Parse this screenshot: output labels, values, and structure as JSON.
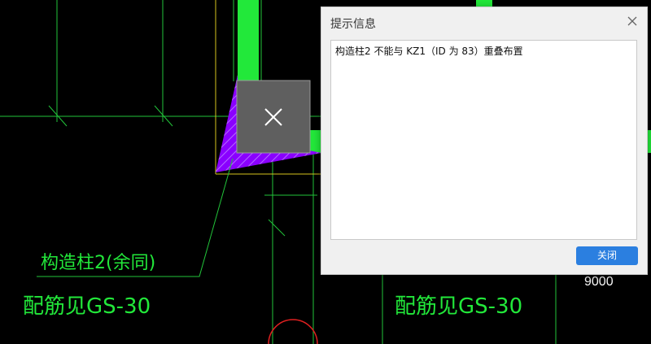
{
  "dialog": {
    "title": "提示信息",
    "message": "构造柱2 不能与 KZ1（ID 为 83）重叠布置",
    "ok_label": "关闭"
  },
  "drawing": {
    "label_column": "构造柱2(余同)",
    "label_rebar_left": "配筋见GS-30",
    "label_rebar_right": "配筋见GS-30",
    "dimension_text": "9000"
  },
  "colors": {
    "cad_green": "#22e83a",
    "column_fill": "#8a00ff",
    "overlay_box": "#5f5f5f",
    "button": "#2b7fe0"
  },
  "icons": {
    "overlay": "close-x-icon",
    "dialog_close": "close-icon"
  }
}
